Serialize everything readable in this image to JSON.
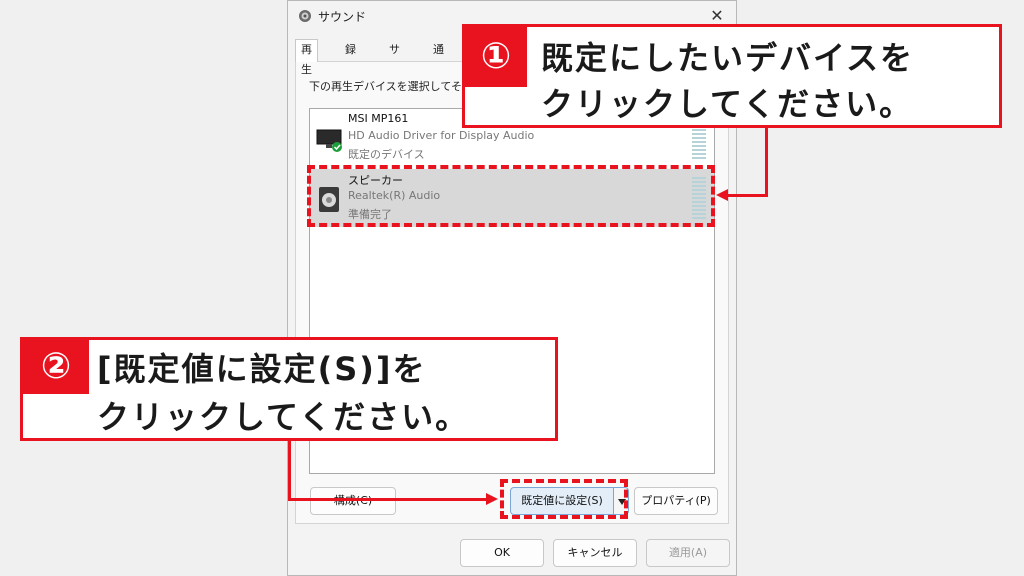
{
  "dialog": {
    "title": "サウンド",
    "tabs": [
      "再生",
      "録音",
      "サウンド",
      "通信"
    ],
    "instruction": "下の再生デバイスを選択してその設定を変更してください:",
    "devices": [
      {
        "name": "MSI MP161",
        "driver": "HD Audio Driver for Display Audio",
        "status": "既定のデバイス",
        "default": true,
        "selected": false
      },
      {
        "name": "スピーカー",
        "driver": "Realtek(R) Audio",
        "status": "準備完了",
        "default": false,
        "selected": true
      }
    ],
    "buttons": {
      "configure": "構成(C)",
      "set_default": "既定値に設定(S)",
      "properties": "プロパティ(P)",
      "ok": "OK",
      "cancel": "キャンセル",
      "apply": "適用(A)"
    }
  },
  "annotations": {
    "step1": {
      "number": "①",
      "line1": "既定にしたいデバイスを",
      "line2": "クリックしてください。"
    },
    "step2": {
      "number": "②",
      "line1": "[既定値に設定(S)]を",
      "line2": "クリックしてください。"
    },
    "accent_color": "#e8131e"
  }
}
